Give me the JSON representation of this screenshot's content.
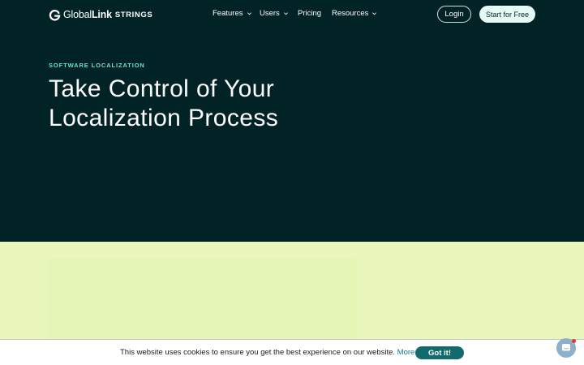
{
  "brand": {
    "global": "Global",
    "link": "Link",
    "product": "STRINGS"
  },
  "nav": {
    "items": [
      {
        "label": "Features",
        "has_dropdown": true
      },
      {
        "label": "Users",
        "has_dropdown": true
      },
      {
        "label": "Pricing",
        "has_dropdown": false
      },
      {
        "label": "Resources",
        "has_dropdown": true
      }
    ],
    "login_label": "Login",
    "start_label": "Start for Free"
  },
  "hero": {
    "eyebrow": "SOFTWARE LOCALIZATION",
    "headline_lines": [
      "Take Control of Your",
      "Localization Process"
    ]
  },
  "cookie": {
    "message": "This website uses cookies to ensure you get the best experience on our website.",
    "more_info": "More info",
    "accept_label": "Got it!"
  },
  "colors": {
    "hero_bg": "#022326",
    "lower_bg": "#e9f7bd",
    "accent": "#6fe0cc",
    "cookie_button": "#126a6d",
    "chat_badge": "#e8333a"
  },
  "icons": {
    "logo": "globallink-g-icon",
    "dropdown": "chevron-down-icon",
    "chat": "chat-bubble-icon"
  }
}
